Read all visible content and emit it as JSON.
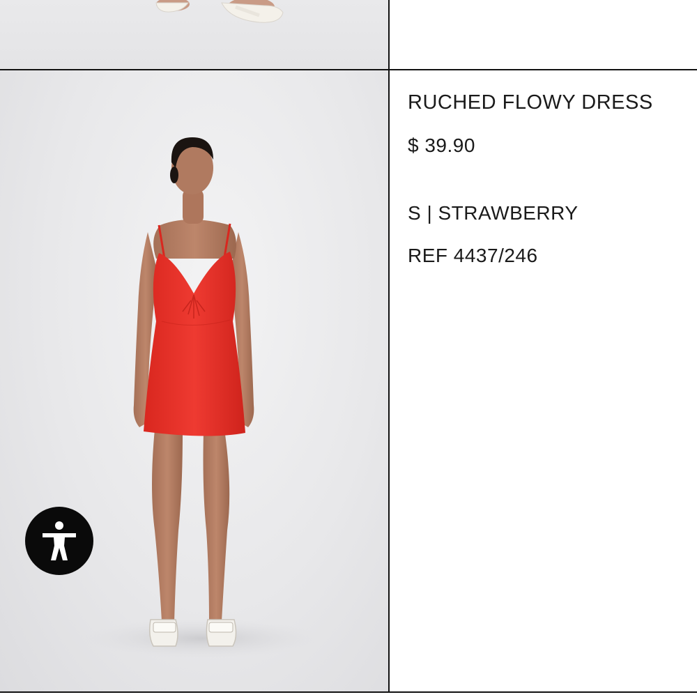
{
  "product": {
    "name": "RUCHED FLOWY DRESS",
    "price": "$ 39.90",
    "variant": "S | STRAWBERRY",
    "ref": "REF 4437/246",
    "color": "#e8322c"
  },
  "icons": {
    "accessibility": "accessibility-icon"
  }
}
